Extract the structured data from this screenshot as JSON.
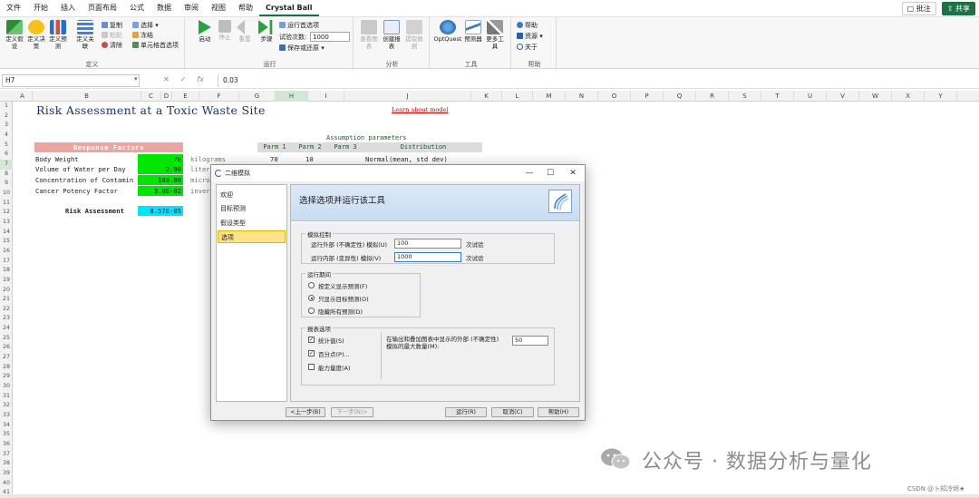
{
  "menu": {
    "items": [
      "文件",
      "开始",
      "插入",
      "页面布局",
      "公式",
      "数据",
      "审阅",
      "视图",
      "帮助",
      "Crystal Ball"
    ],
    "active_index": 9,
    "comments_label": "批注",
    "share_label": "共享"
  },
  "ribbon": {
    "define_group": {
      "label": "定义",
      "btn1": "定义假设",
      "btn2": "定义决策",
      "btn3": "定义预测",
      "btn4": "定义关联",
      "copy": "复制",
      "paste": "粘贴",
      "clear": "清除",
      "select": "选择",
      "freeze": "冻结",
      "cell_prefs": "单元格首选项"
    },
    "run_group": {
      "label": "运行",
      "start": "启动",
      "stop": "停止",
      "reset": "重置",
      "step": "步骤",
      "run_prefs": "运行首选项",
      "trials_label": "试验次数:",
      "trials_value": "1000",
      "save_restore": "保存或还原"
    },
    "analyze_group": {
      "label": "分析",
      "view_charts": "查看图表",
      "create_report": "创建报表",
      "extract_data": "提取数据"
    },
    "tools_group": {
      "label": "工具",
      "optquest": "OptQuest",
      "predictor": "预测器",
      "more_tools": "更多工具"
    },
    "help_group": {
      "label": "帮助",
      "help": "帮助",
      "resources": "资源",
      "about": "关于"
    }
  },
  "formula_bar": {
    "cell_ref": "H7",
    "formula": "0.03"
  },
  "columns": [
    "A",
    "B",
    "C",
    "D",
    "E",
    "F",
    "G",
    "H",
    "I",
    "J",
    "K",
    "L",
    "M",
    "N",
    "O",
    "P",
    "Q",
    "R",
    "S",
    "T",
    "U",
    "V",
    "W",
    "X",
    "Y"
  ],
  "selected_column": "H",
  "rows": [
    "1",
    "2",
    "3",
    "4",
    "5",
    "6",
    "7",
    "8",
    "9",
    "10",
    "11",
    "12",
    "13",
    "14",
    "15",
    "16",
    "17",
    "18",
    "19",
    "20",
    "21",
    "22",
    "23",
    "24",
    "25",
    "26",
    "27",
    "28",
    "29",
    "30",
    "31",
    "32",
    "33",
    "34",
    "35",
    "36",
    "37",
    "38",
    "39",
    "40",
    "41"
  ],
  "selected_row": "7",
  "sheet": {
    "title": "Risk Assessment at a Toxic Waste Site",
    "learn_link": "Learn about model",
    "assumption_header": "Assumption parameters",
    "response_header": "Response Factors",
    "parm_headers": [
      "Parm 1",
      "Parm 2",
      "Parm 3",
      "Distribution"
    ],
    "factors": [
      {
        "label": "Body Weight",
        "value": "70",
        "unit": "kilograms",
        "parm1": "70",
        "parm2": "10",
        "dist": "Normal(mean, std dev)"
      },
      {
        "label": "Volume of Water per Day",
        "value": "2.90",
        "unit": "liter"
      },
      {
        "label": "Concentration of Contamin",
        "value": "100.00",
        "unit": "micro"
      },
      {
        "label": "Cancer Potency Factor",
        "value": "3.0E-02",
        "unit": "inver"
      }
    ],
    "risk_label": "Risk Assessment",
    "risk_value": "8.57E-05"
  },
  "dialog": {
    "title": "二维模拟",
    "nav": [
      "欢迎",
      "目标预测",
      "假设类型",
      "选项"
    ],
    "active_nav": 3,
    "header_title": "选择选项并运行该工具",
    "sim_control": {
      "legend": "模拟控制",
      "outer_label": "运行外部 (不确定性) 模拟(U)",
      "outer_value": "100",
      "outer_suffix": "次试验",
      "inner_label": "运行内部 (变异性) 模拟(V)",
      "inner_value": "1000",
      "inner_suffix": "次试验"
    },
    "run_period": {
      "legend": "运行期间",
      "opt1": "按定义显示预测(F)",
      "opt2": "只显示目标预测(O)",
      "opt3": "隐藏所有预测(D)",
      "selected": 2
    },
    "report_opts": {
      "legend": "报表选项",
      "chk1": "统计值(S)",
      "chk2": "百分点(P)...",
      "chk3": "能力量度(A)",
      "chk1_checked": true,
      "chk2_checked": true,
      "chk3_checked": false,
      "max_label_line1": "在输出和叠加图表中显示的外部 (不确定性)",
      "max_label_line2": "模拟的最大数量(M):",
      "max_value": "50"
    },
    "buttons": {
      "back": "<上一步(B)",
      "next": "下一步(N)>",
      "run": "运行(R)",
      "cancel": "取消(C)",
      "help": "帮助(H)"
    }
  },
  "watermark": {
    "text": "公众号 · 数据分析与量化",
    "csdn": "CSDN @卜知冷烬★"
  },
  "colors": {
    "excel_green": "#1e7145",
    "response_header": "#e9a6a2",
    "value_green": "#00e600",
    "value_cyan": "#00e5ff",
    "nav_active": "#ffe38a"
  }
}
